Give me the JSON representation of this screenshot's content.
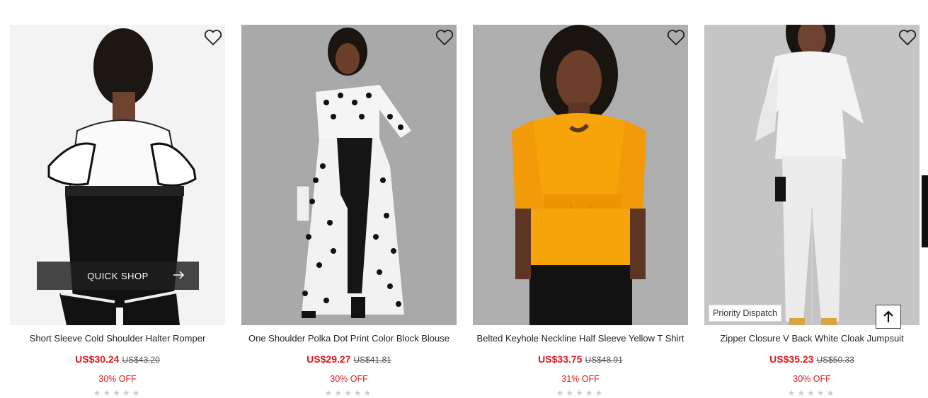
{
  "products": [
    {
      "title": "Short Sleeve Cold Shoulder Halter Romper",
      "price": "US$30.24",
      "old_price": "US$43.20",
      "discount": "30% OFF"
    },
    {
      "title": "One Shoulder Polka Dot Print Color Block Blouse",
      "price": "US$29.27",
      "old_price": "US$41.81",
      "discount": "30% OFF"
    },
    {
      "title": "Belted Keyhole Neckline Half Sleeve Yellow T Shirt",
      "price": "US$33.75",
      "old_price": "US$48.91",
      "discount": "31% OFF"
    },
    {
      "title": "Zipper Closure V Back White Cloak Jumpsuit",
      "price": "US$35.23",
      "old_price": "US$50.33",
      "discount": "30% OFF"
    }
  ],
  "quick_shop": "QUICK SHOP",
  "badge": "Priority Dispatch",
  "icons": {
    "wishlist": "heart-outline-icon",
    "quick_shop_arrow": "arrow-right-icon",
    "back_to_top": "arrow-up-icon"
  },
  "colors": {
    "sale_price": "#e0191f",
    "text": "#222222"
  }
}
